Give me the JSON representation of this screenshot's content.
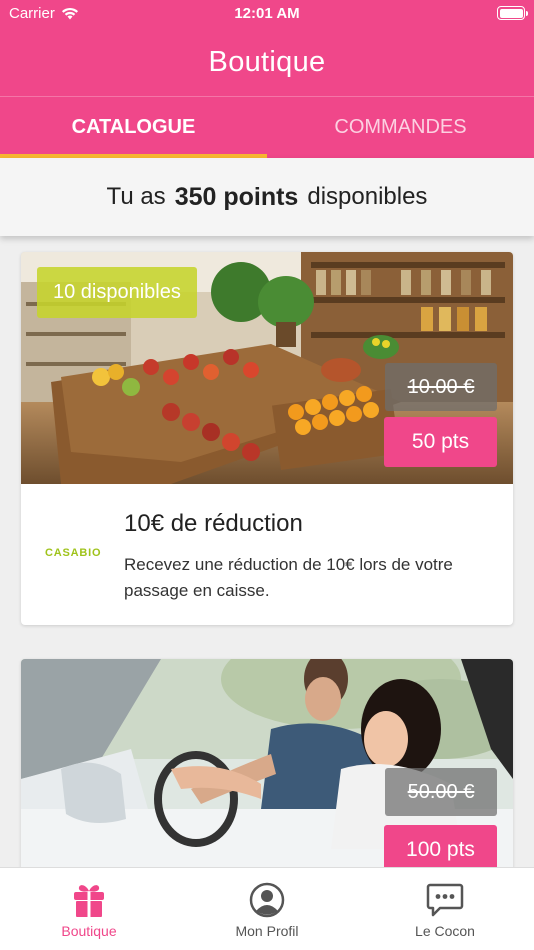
{
  "status_bar": {
    "carrier": "Carrier",
    "time": "12:01 AM"
  },
  "header": {
    "title": "Boutique"
  },
  "tabs": [
    {
      "label": "CATALOGUE",
      "active": true
    },
    {
      "label": "COMMANDES",
      "active": false
    }
  ],
  "points": {
    "prefix": "Tu as",
    "value": "350 points",
    "suffix": "disponibles"
  },
  "offers": [
    {
      "availability": "10 disponibles",
      "old_price": "10.00 €",
      "price": "50 pts",
      "brand": "CASABIO",
      "title": "10€ de réduction",
      "description": "Recevez une réduction de 10€ lors de votre passage en caisse."
    },
    {
      "old_price": "50.00 €",
      "price": "100 pts"
    }
  ],
  "tabbar": [
    {
      "label": "Boutique",
      "icon": "gift-icon",
      "active": true
    },
    {
      "label": "Mon Profil",
      "icon": "user-icon",
      "active": false
    },
    {
      "label": "Le Cocon",
      "icon": "chat-icon",
      "active": false
    }
  ],
  "colors": {
    "brand": "#f0478a",
    "tab_indicator": "#f7b731",
    "availability": "#c6d42c"
  }
}
